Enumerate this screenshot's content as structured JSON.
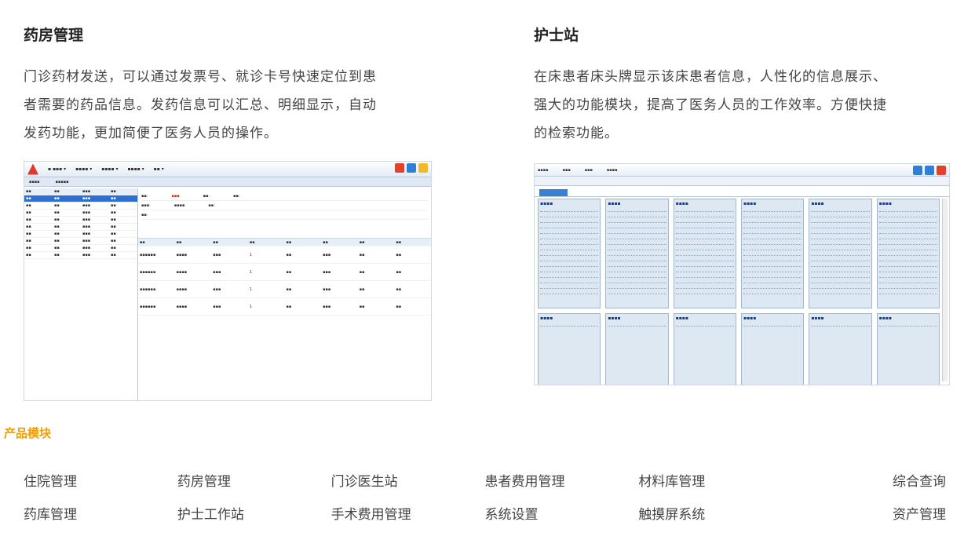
{
  "pharmacy": {
    "title": "药房管理",
    "desc": [
      "门诊药材发送，可以通过发票号、就诊卡号快速定位到患",
      "者需要的药品信息。发药信息可以汇总、明细显示，自动",
      "发药功能，更加简便了医务人员的操作。"
    ]
  },
  "nurse": {
    "title": "护士站",
    "desc": [
      "在床患者床头牌显示该床患者信息，人性化的信息展示、",
      "强大的功能模块，提高了医务人员的工作效率。方便快捷",
      "的检索功能。"
    ]
  },
  "modules": {
    "title": "产品模块",
    "rows": [
      [
        "住院管理",
        "药房管理",
        "门诊医生站",
        "患者费用管理",
        "材料库管理",
        "综合查询"
      ],
      [
        "药库管理",
        "护士工作站",
        "手术费用管理",
        "系统设置",
        "触摸屏系统",
        "资产管理"
      ]
    ]
  },
  "colors": {
    "accent": "#f39c00",
    "blue": "#2f6fcf",
    "red": "#d12a1f"
  }
}
